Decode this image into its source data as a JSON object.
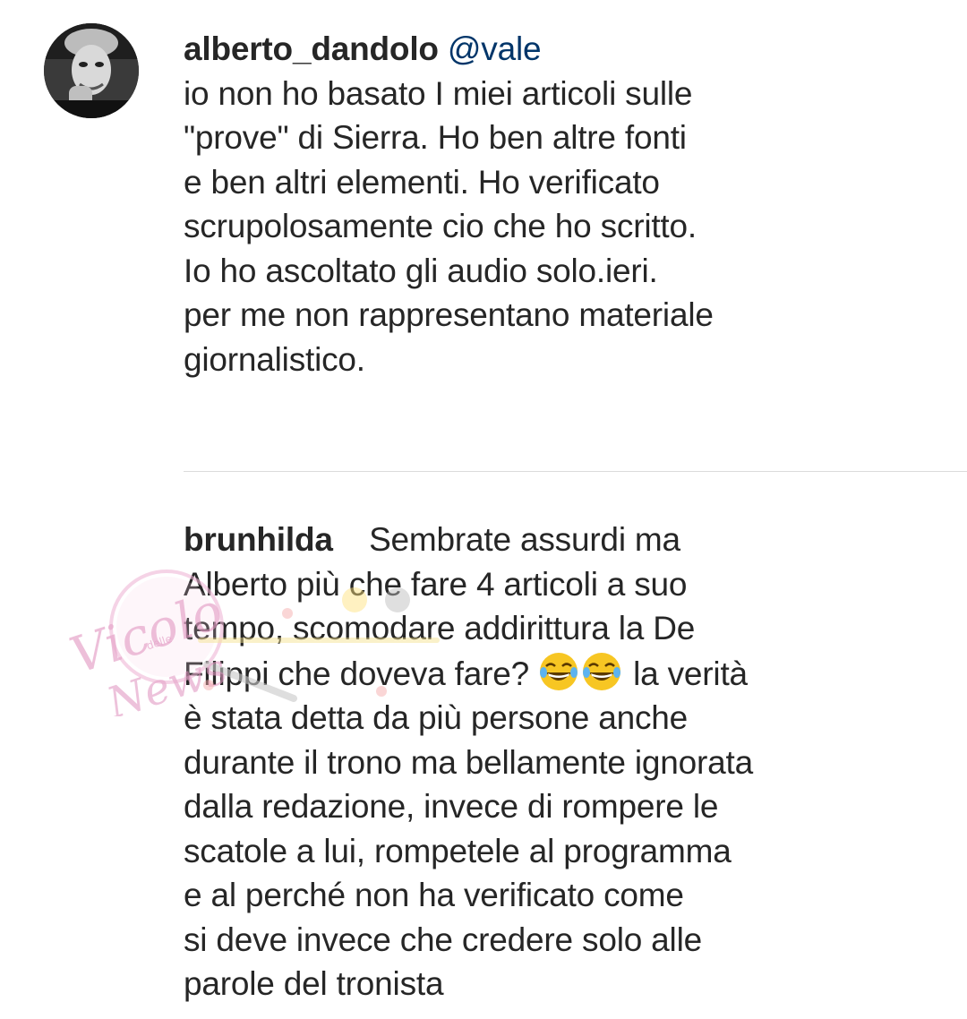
{
  "comments": [
    {
      "username": "alberto_dandolo",
      "mention": "@vale",
      "text": "io non ho basato I miei articoli sulle\n\"prove\" di Sierra. Ho ben altre fonti\ne ben altri elementi. Ho verificato\nscrupolosamente cio che ho scritto.\nIo ho ascoltato gli audio solo.ieri.\nper me non rappresentano materiale\ngiornalistico."
    },
    {
      "username": "brunhilda",
      "text_before_emoji": "    Sembrate assurdi ma\nAlberto più che fare 4 articoli a suo\ntempo, scomodare addirittura la De\nFilippi che doveva fare? ",
      "emoji": [
        "face-with-tears-of-joy-icon",
        "face-with-tears-of-joy-icon"
      ],
      "text_after_emoji": " la verità\nè stata detta da più persone anche\ndurante il trono ma bellamente ignorata\ndalla redazione, invece di rompere le\nscatole a lui, rompetele al programma\ne al perché non ha verificato come\nsi deve invece che credere solo alle\nparole del tronista"
    }
  ],
  "watermark": {
    "text_main": "Vicolo",
    "text_small": "delle",
    "text_second": "News"
  },
  "colors": {
    "text": "#262626",
    "mention": "#003569",
    "divider": "#dbdbdb",
    "watermark": "#e39bc4"
  }
}
